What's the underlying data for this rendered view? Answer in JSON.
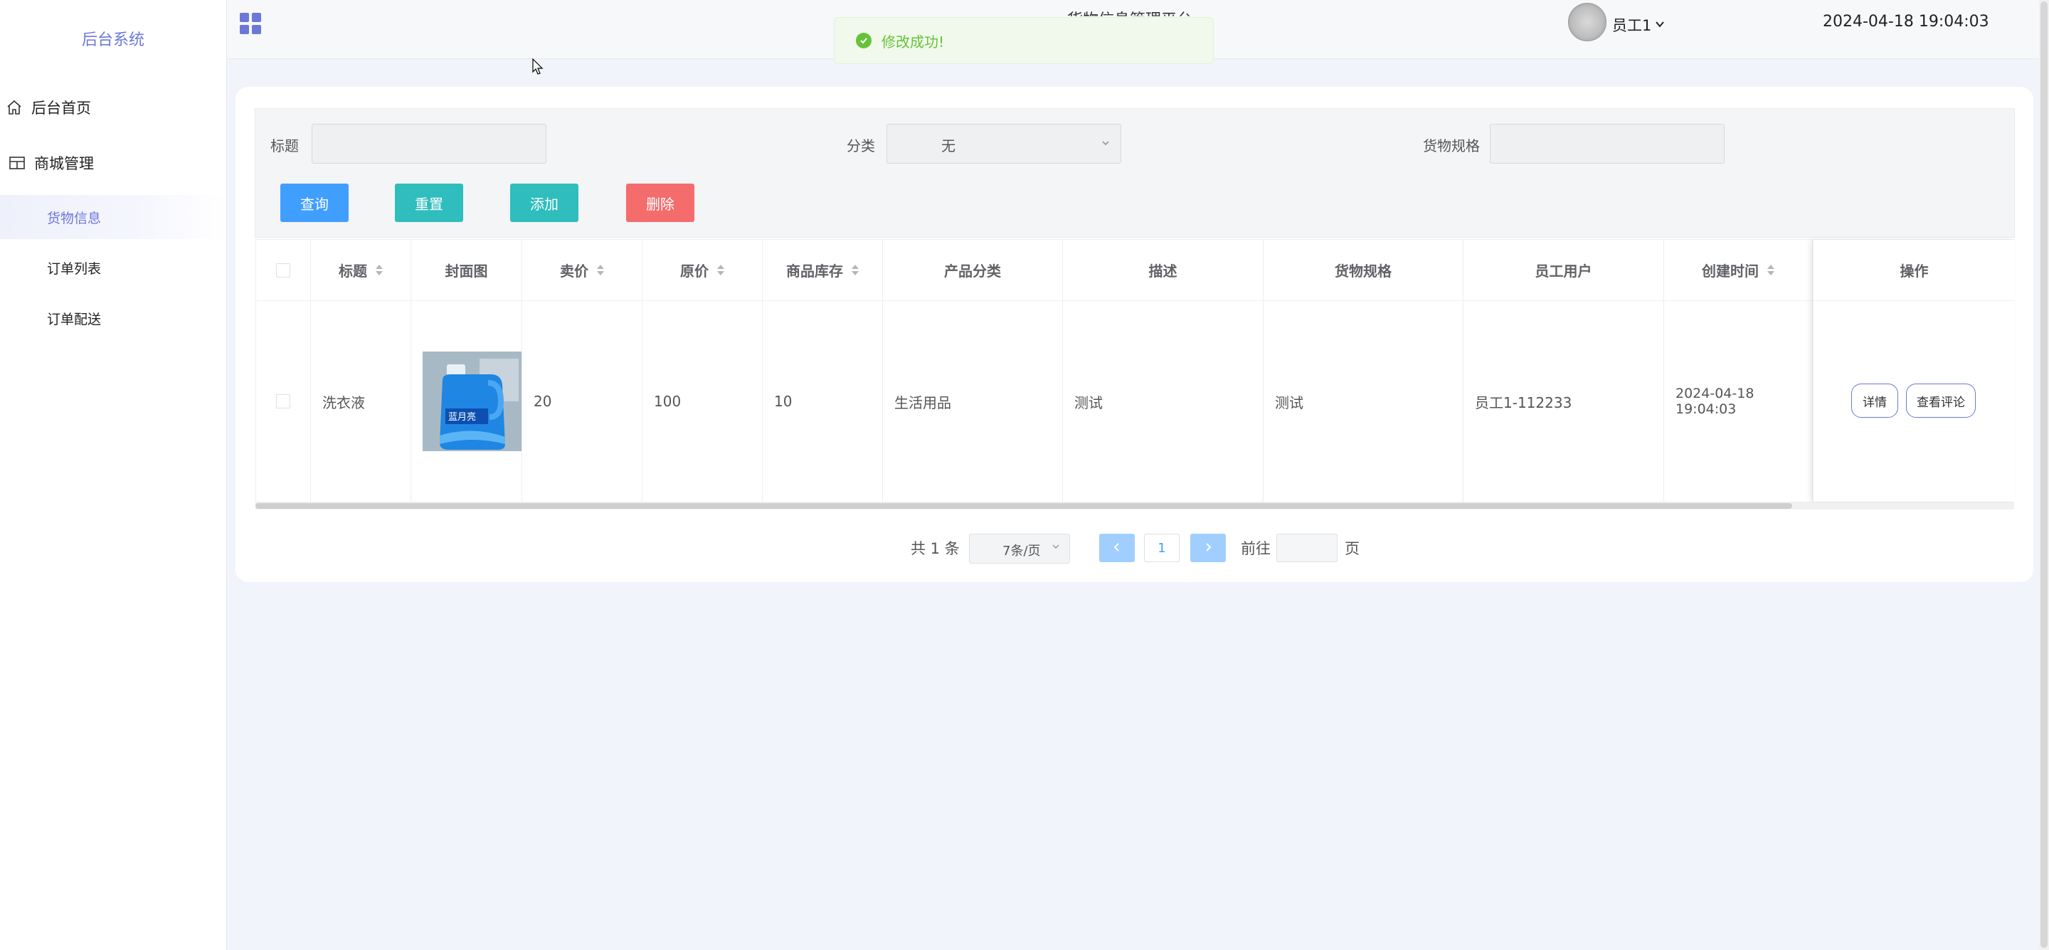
{
  "sidebar": {
    "brand": "后台系统",
    "items": [
      {
        "label": "后台首页",
        "icon": "home-icon"
      },
      {
        "label": "商城管理",
        "icon": "shop-management-icon"
      },
      {
        "label": "货物信息",
        "active": true
      },
      {
        "label": "订单列表"
      },
      {
        "label": "订单配送"
      }
    ]
  },
  "header": {
    "title": "货物信息管理平台",
    "user": "员工1",
    "datetime": "2024-04-18 19:04:03"
  },
  "toast": {
    "message": "修改成功!",
    "color": "#67c23a"
  },
  "filters": {
    "title_label": "标题",
    "category_label": "分类",
    "category_value": "无",
    "spec_label": "货物规格"
  },
  "actions": {
    "query": "查询",
    "reset": "重置",
    "add": "添加",
    "delete": "删除"
  },
  "colors": {
    "query": "#409eff",
    "reset": "#2fbdbd",
    "add": "#2fbdbd",
    "delete": "#f56c6c",
    "accent": "#6c78d8"
  },
  "table": {
    "columns": [
      "标题",
      "封面图",
      "卖价",
      "原价",
      "商品库存",
      "产品分类",
      "描述",
      "货物规格",
      "员工用户",
      "创建时间",
      "操作"
    ],
    "rows": [
      {
        "title": "洗衣液",
        "cover": "laundry-detergent-bottle",
        "price": "20",
        "original_price": "100",
        "stock": "10",
        "category": "生活用品",
        "description": "测试",
        "spec": "测试",
        "employee": "员工1-112233",
        "created": "2024-04-18 19:04:03",
        "op_detail": "详情",
        "op_reviews": "查看评论"
      }
    ]
  },
  "pagination": {
    "total": "共 1 条",
    "page_size": "7条/页",
    "current_page": "1",
    "goto_label": "前往",
    "page_unit": "页"
  }
}
